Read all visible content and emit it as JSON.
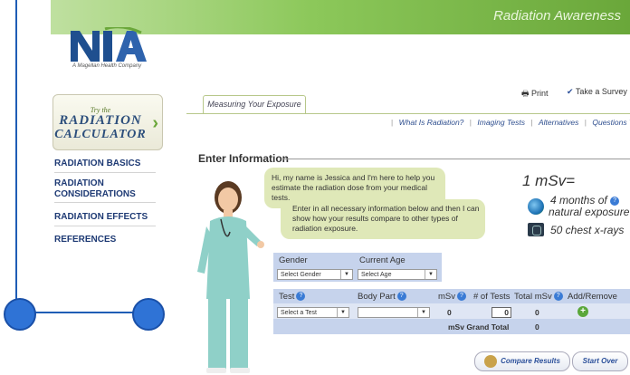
{
  "header": {
    "title": "Radiation Awareness"
  },
  "logo": {
    "letters": "NIA",
    "tagline": "A Magellan Health Company"
  },
  "calculator": {
    "try": "Try the",
    "line1": "RADIATION",
    "line2": "CALCULATOR"
  },
  "sidebar": {
    "items": [
      {
        "label": "RADIATION BASICS"
      },
      {
        "label": "RADIATION CONSIDERATIONS"
      },
      {
        "label": "RADIATION EFFECTS"
      },
      {
        "label": "REFERENCES"
      }
    ]
  },
  "tab": {
    "label": "Measuring Your Exposure"
  },
  "toolbar": {
    "print": "Print",
    "survey": "Take a Survey"
  },
  "subnav": {
    "links": [
      "What Is Radiation?",
      "Imaging Tests",
      "Alternatives",
      "Questions To Ask"
    ]
  },
  "section": {
    "title": "Enter Information"
  },
  "bubble": {
    "text1": "Hi, my name is Jessica and I'm here to help you estimate the radiation dose from your medical tests.",
    "text2": "Enter in all necessary information below and then I can show how your results compare to other types of radiation exposure."
  },
  "info": {
    "msv": "1 mSv=",
    "months1": "4 months of",
    "months2": "natural exposure",
    "chest": "50 chest x-rays"
  },
  "form": {
    "gender_label": "Gender",
    "age_label": "Current Age",
    "gender_value": "Select Gender",
    "age_value": "Select Age",
    "test_label": "Test",
    "bodypart_label": "Body Part",
    "msv_label": "mSv",
    "tests_label": "# of Tests",
    "total_label": "Total mSv",
    "addremove_label": "Add/Remove",
    "test_value": "Select a Test",
    "bodypart_value": "",
    "msv_value": "0",
    "tests_value": "0",
    "total_value": "0",
    "grand_total_label": "mSv Grand Total",
    "grand_total_value": "0"
  },
  "buttons": {
    "compare": "Compare Results",
    "startover": "Start Over"
  },
  "colors": {
    "brand_green": "#6aa73a",
    "nav_blue": "#1e3a74",
    "form_blue": "#c6d3ec"
  }
}
